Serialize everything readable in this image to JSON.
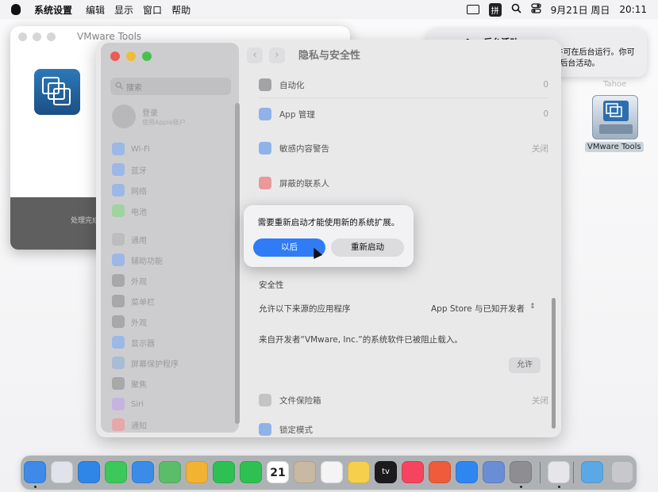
{
  "menubar": {
    "app_name": "系统设置",
    "menus": [
      "编辑",
      "显示",
      "窗口",
      "帮助"
    ],
    "ime": "拼",
    "date": "9月21日 周日",
    "time": "20:11"
  },
  "vmware_window": {
    "title": "VMware Tools",
    "footer": "处理完成"
  },
  "desktop": {
    "icon_label": "VMware Tools",
    "faded_label": "Tahoe"
  },
  "notification": {
    "title": "App后台活动",
    "body": "来自“VMware, Inc.”的软件可在后台运行。你可以在“登录项与扩展”中管理后台活动。"
  },
  "settings": {
    "page_title": "隐私与安全性",
    "search_placeholder": "搜索",
    "profile_name": "登录",
    "profile_sub": "使用Apple账户",
    "sidebar": [
      {
        "label": "Wi-Fi",
        "color": "#9bb8e6"
      },
      {
        "label": "蓝牙",
        "color": "#9bb8e6"
      },
      {
        "label": "网络",
        "color": "#9bb8e6"
      },
      {
        "label": "电池",
        "color": "#9fd4a0"
      },
      {
        "label": "通用",
        "color": "#bdbdc0"
      },
      {
        "label": "辅助功能",
        "color": "#9bb8e6"
      },
      {
        "label": "外观",
        "color": "#a8a8aa"
      },
      {
        "label": "菜单栏",
        "color": "#a8a8aa"
      },
      {
        "label": "外观",
        "color": "#a8a8aa"
      },
      {
        "label": "显示器",
        "color": "#9bb8e6"
      },
      {
        "label": "屏幕保护程序",
        "color": "#a8bcd6"
      },
      {
        "label": "聚焦",
        "color": "#a8a8aa"
      },
      {
        "label": "Siri",
        "color": "#c4b4de"
      },
      {
        "label": "通知",
        "color": "#e6a8a8"
      }
    ],
    "rows": [
      {
        "label": "自动化",
        "value": "0",
        "color": "#a3a3a5"
      },
      {
        "label": "App 管理",
        "value": "0",
        "color": "#8fb3e8"
      },
      {
        "label": "敏感内容警告",
        "value": "关闭",
        "color": "#8fb3e8"
      },
      {
        "label": "屏蔽的联系人",
        "value": "",
        "color": "#e89a9a"
      }
    ],
    "security_header": "安全性",
    "allow_label": "允许以下来源的应用程序",
    "allow_value": "App Store 与已知开发者",
    "blocked_msg": "来自开发者“VMware, Inc.”的系统软件已被阻止载入。",
    "allow_button": "允许",
    "filevault_label": "文件保险箱",
    "filevault_value": "关闭",
    "lockdown_label": "锁定模式"
  },
  "dialog": {
    "message": "需要重新启动才能使用新的系统扩展。",
    "later_button": "以后",
    "restart_button": "重新启动"
  },
  "dock": {
    "calendar_day": "21",
    "tv_label": "tv",
    "apps": [
      {
        "name": "finder-icon",
        "color": "#3e8ae8",
        "dot": true
      },
      {
        "name": "launchpad-icon",
        "color": "#e0e4ea",
        "dot": false
      },
      {
        "name": "safari-icon",
        "color": "#2f86e6",
        "dot": false
      },
      {
        "name": "messages-icon",
        "color": "#3cc85a",
        "dot": false
      },
      {
        "name": "mail-icon",
        "color": "#3a8ce8",
        "dot": false
      },
      {
        "name": "maps-icon",
        "color": "#5bbd6a",
        "dot": false
      },
      {
        "name": "photos-icon",
        "color": "#f2b233",
        "dot": false
      },
      {
        "name": "facetime-icon",
        "color": "#2fc053",
        "dot": false
      },
      {
        "name": "phone-icon",
        "color": "#2fc053",
        "dot": false
      },
      {
        "name": "calendar-icon",
        "color": "#ffffff",
        "dot": false
      },
      {
        "name": "contacts-icon",
        "color": "#c9b8a2",
        "dot": false
      },
      {
        "name": "reminders-icon",
        "color": "#f4f4f4",
        "dot": false
      },
      {
        "name": "notes-icon",
        "color": "#f6d04d",
        "dot": false
      },
      {
        "name": "tv-icon",
        "color": "#1b1b1d",
        "dot": false
      },
      {
        "name": "music-icon",
        "color": "#f5445e",
        "dot": false
      },
      {
        "name": "launcher-icon",
        "color": "#f05b3b",
        "dot": false
      },
      {
        "name": "app-store-icon",
        "color": "#2f86f0",
        "dot": false
      },
      {
        "name": "iphone-mirroring-icon",
        "color": "#6a8ed6",
        "dot": false
      },
      {
        "name": "system-settings-icon",
        "color": "#8d8d92",
        "dot": true
      },
      {
        "name": "installer-icon",
        "color": "#e6e6e8",
        "dot": true
      },
      {
        "name": "downloads-folder-icon",
        "color": "#5aa9e6",
        "dot": false
      },
      {
        "name": "trash-icon",
        "color": "#c8c8cb",
        "dot": false
      }
    ]
  }
}
